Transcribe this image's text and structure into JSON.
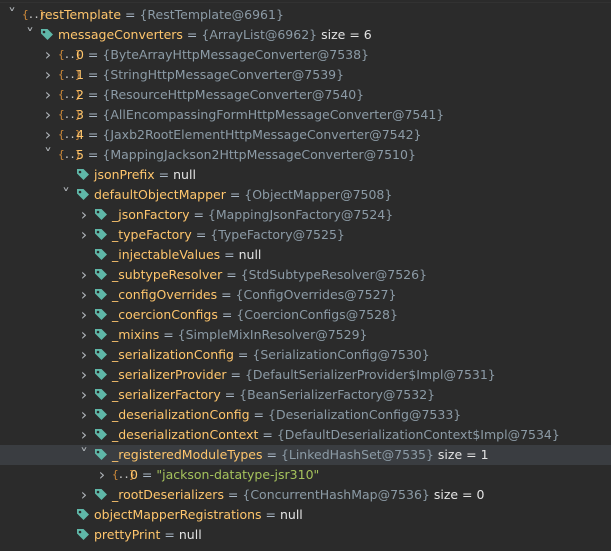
{
  "tree": [
    {
      "indent": 0,
      "arrow": "down",
      "icon": "array-icon",
      "name": "restTemplate",
      "value": "{RestTemplate@6961}"
    },
    {
      "indent": 1,
      "arrow": "down",
      "icon": "field-tag-icon",
      "name": "messageConverters",
      "value": "{ArrayList@6962}",
      "extra": "size = 6"
    },
    {
      "indent": 2,
      "arrow": "right",
      "icon": "array-icon",
      "name": "0",
      "value": "{ByteArrayHttpMessageConverter@7538}"
    },
    {
      "indent": 2,
      "arrow": "right",
      "icon": "array-icon",
      "name": "1",
      "value": "{StringHttpMessageConverter@7539}"
    },
    {
      "indent": 2,
      "arrow": "right",
      "icon": "array-icon",
      "name": "2",
      "value": "{ResourceHttpMessageConverter@7540}"
    },
    {
      "indent": 2,
      "arrow": "right",
      "icon": "array-icon",
      "name": "3",
      "value": "{AllEncompassingFormHttpMessageConverter@7541}"
    },
    {
      "indent": 2,
      "arrow": "right",
      "icon": "array-icon",
      "name": "4",
      "value": "{Jaxb2RootElementHttpMessageConverter@7542}"
    },
    {
      "indent": 2,
      "arrow": "down",
      "icon": "array-icon",
      "name": "5",
      "value": "{MappingJackson2HttpMessageConverter@7510}"
    },
    {
      "indent": 3,
      "arrow": "none",
      "icon": "field-tag-icon",
      "name": "jsonPrefix",
      "null": "null"
    },
    {
      "indent": 3,
      "arrow": "down",
      "icon": "field-tag-icon",
      "name": "defaultObjectMapper",
      "value": "{ObjectMapper@7508}"
    },
    {
      "indent": 4,
      "arrow": "right",
      "icon": "field-tag-icon",
      "name": "_jsonFactory",
      "value": "{MappingJsonFactory@7524}"
    },
    {
      "indent": 4,
      "arrow": "right",
      "icon": "field-tag-icon",
      "name": "_typeFactory",
      "value": "{TypeFactory@7525}"
    },
    {
      "indent": 4,
      "arrow": "none",
      "icon": "field-tag-icon",
      "name": "_injectableValues",
      "null": "null"
    },
    {
      "indent": 4,
      "arrow": "right",
      "icon": "field-tag-icon",
      "name": "_subtypeResolver",
      "value": "{StdSubtypeResolver@7526}"
    },
    {
      "indent": 4,
      "arrow": "right",
      "icon": "field-tag-icon",
      "name": "_configOverrides",
      "value": "{ConfigOverrides@7527}"
    },
    {
      "indent": 4,
      "arrow": "right",
      "icon": "field-tag-icon",
      "name": "_coercionConfigs",
      "value": "{CoercionConfigs@7528}"
    },
    {
      "indent": 4,
      "arrow": "right",
      "icon": "field-tag-icon",
      "name": "_mixins",
      "value": "{SimpleMixInResolver@7529}"
    },
    {
      "indent": 4,
      "arrow": "right",
      "icon": "field-tag-icon",
      "name": "_serializationConfig",
      "value": "{SerializationConfig@7530}"
    },
    {
      "indent": 4,
      "arrow": "right",
      "icon": "field-tag-icon",
      "name": "_serializerProvider",
      "value": "{DefaultSerializerProvider$Impl@7531}"
    },
    {
      "indent": 4,
      "arrow": "right",
      "icon": "field-tag-icon",
      "name": "_serializerFactory",
      "value": "{BeanSerializerFactory@7532}"
    },
    {
      "indent": 4,
      "arrow": "right",
      "icon": "field-tag-icon",
      "name": "_deserializationConfig",
      "value": "{DeserializationConfig@7533}"
    },
    {
      "indent": 4,
      "arrow": "right",
      "icon": "field-tag-icon",
      "name": "_deserializationContext",
      "value": "{DefaultDeserializationContext$Impl@7534}"
    },
    {
      "indent": 4,
      "arrow": "down",
      "icon": "field-tag-icon",
      "name": "_registeredModuleTypes",
      "value": "{LinkedHashSet@7535}",
      "extra": "size = 1",
      "selected": true
    },
    {
      "indent": 5,
      "arrow": "right",
      "icon": "array-icon",
      "name": "0",
      "str": "\"jackson-datatype-jsr310\""
    },
    {
      "indent": 4,
      "arrow": "right",
      "icon": "field-tag-icon",
      "name": "_rootDeserializers",
      "value": "{ConcurrentHashMap@7536}",
      "extra": "size = 0"
    },
    {
      "indent": 3,
      "arrow": "none",
      "icon": "field-tag-icon",
      "name": "objectMapperRegistrations",
      "null": "null"
    },
    {
      "indent": 3,
      "arrow": "none",
      "icon": "field-tag-icon",
      "name": "prettyPrint",
      "null": "null"
    }
  ],
  "colors": {
    "background": "#2b2b2b",
    "name": "#ffc66d",
    "value": "#8c9ba6",
    "string": "#a5c25c",
    "tag_icon": "#5fb7a8",
    "array_bracket": "#d08b3a",
    "selected_row": "#3a3d41"
  }
}
